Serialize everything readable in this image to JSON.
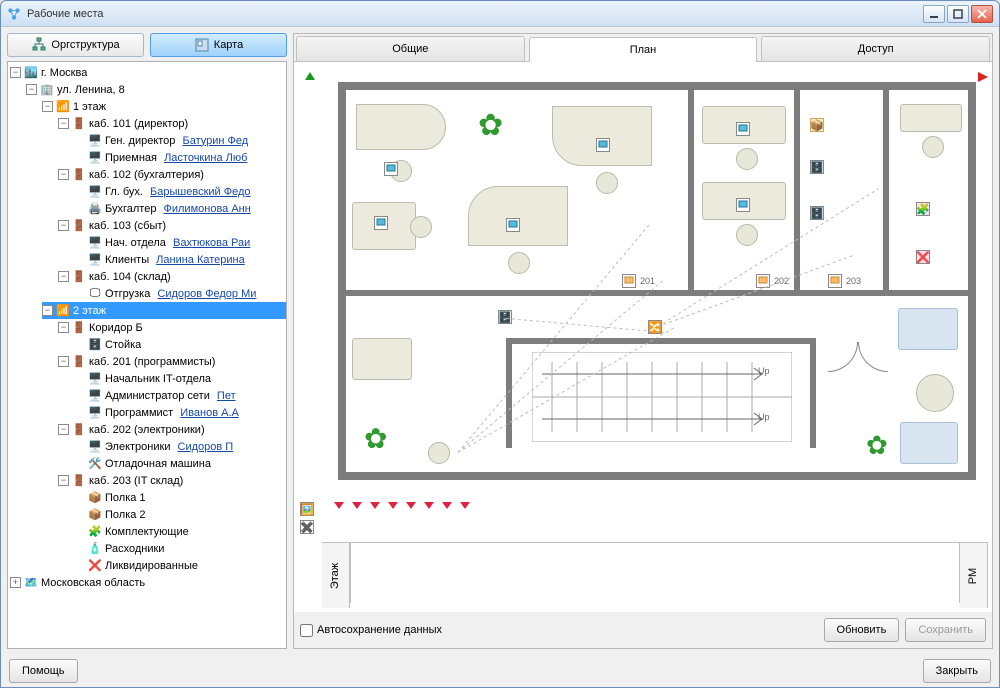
{
  "window": {
    "title": "Рабочие места"
  },
  "left_tabs": {
    "org": "Оргструктура",
    "map": "Карта"
  },
  "right_tabs": {
    "general": "Общие",
    "plan": "План",
    "access": "Доступ"
  },
  "tree": {
    "city": "г. Москва",
    "addr": "ул. Ленина, 8",
    "f1": "1 этаж",
    "r101": "каб. 101 (директор)",
    "r101a_lbl": "Ген. директор",
    "r101a_lnk": "Батурин Фед",
    "r101b_lbl": "Приемная",
    "r101b_lnk": "Ласточкина Люб",
    "r102": "каб. 102 (бухгалтерия)",
    "r102a_lbl": "Гл. бух.",
    "r102a_lnk": "Барышевский Федо",
    "r102b_lbl": "Бухгалтер",
    "r102b_lnk": "Филимонова Анн",
    "r103": "каб. 103 (сбыт)",
    "r103a_lbl": "Нач. отдела",
    "r103a_lnk": "Вахтюкова Раи",
    "r103b_lbl": "Клиенты",
    "r103b_lnk": "Ланина Катерина",
    "r104": "каб. 104 (склад)",
    "r104a_lbl": "Отгрузка",
    "r104a_lnk": "Сидоров Федор Ми",
    "f2": "2 этаж",
    "corB": "Коридор Б",
    "rack": "Стойка",
    "r201": "каб. 201 (программисты)",
    "r201a_lbl": "Начальник IT-отдела",
    "r201b_lbl": "Администратор сети",
    "r201b_lnk": "Пет",
    "r201c_lbl": "Программист",
    "r201c_lnk": "Иванов А.А",
    "r202": "каб. 202 (электроники)",
    "r202a_lbl": "Электроники",
    "r202a_lnk": "Сидоров П",
    "r202b_lbl": "Отладочная машина",
    "r203": "каб. 203 (IT склад)",
    "shelf1": "Полка 1",
    "shelf2": "Полка 2",
    "kits": "Комплектующие",
    "supplies": "Расходники",
    "disposed": "Ликвидированные",
    "region": "Московская область"
  },
  "plan": {
    "room_201": "201",
    "room_202": "202",
    "room_203": "203",
    "up": "Up",
    "axis_floor": "Этаж",
    "axis_rm": "РМ"
  },
  "footer": {
    "autosave": "Автосохранение данных",
    "refresh": "Обновить",
    "save": "Сохранить"
  },
  "bottom": {
    "help": "Помощь",
    "close": "Закрыть"
  }
}
